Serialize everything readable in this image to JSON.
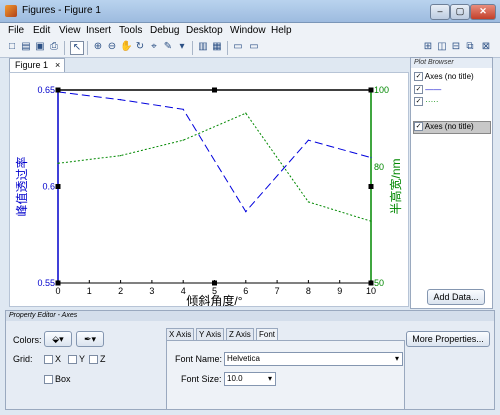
{
  "window": {
    "title": "Figures - Figure 1",
    "min": "–",
    "max": "▢",
    "close": "✕"
  },
  "menu": [
    "File",
    "Edit",
    "View",
    "Insert",
    "Tools",
    "Debug",
    "Desktop",
    "Window",
    "Help"
  ],
  "figure_tab": {
    "label": "Figure 1",
    "close": "×"
  },
  "chart_data": {
    "type": "line",
    "xlabel": "倾斜角度/°",
    "ylabel_left": "峰值透过率",
    "ylabel_right": "半高宽/nm",
    "x": [
      0,
      2,
      4,
      6,
      8,
      10
    ],
    "xticks": [
      "0",
      "1",
      "2",
      "3",
      "4",
      "5",
      "6",
      "7",
      "8",
      "9",
      "10"
    ],
    "xlim": [
      0,
      10
    ],
    "left_axis": {
      "ylim": [
        0.55,
        0.65
      ],
      "ticks": [
        "0.55",
        "0.6",
        "0.65"
      ],
      "color": "#0000cc"
    },
    "right_axis": {
      "ylim": [
        50,
        100
      ],
      "ticks": [
        "50",
        "80",
        "100"
      ],
      "color": "#008800"
    },
    "series": [
      {
        "axis": "left",
        "style": "dashed",
        "color": "#0000dd",
        "values": [
          0.649,
          0.645,
          0.64,
          0.587,
          0.624,
          0.615
        ]
      },
      {
        "axis": "right",
        "style": "dotted",
        "color": "#008800",
        "values": [
          81,
          83,
          87,
          94,
          71,
          66
        ]
      }
    ]
  },
  "plot_browser": {
    "title": "Plot Browser",
    "items": [
      "Axes (no title)",
      "——",
      "·····"
    ],
    "selected_item": "Axes (no title)",
    "add_data": "Add Data..."
  },
  "property_editor": {
    "title": "Property Editor - Axes",
    "colors_label": "Colors:",
    "grid_label": "Grid:",
    "grid_x": "X",
    "grid_y": "Y",
    "grid_z": "Z",
    "box_label": "Box",
    "tabs": [
      "X Axis",
      "Y Axis",
      "Z Axis",
      "Font"
    ],
    "active_tab": "Font",
    "font_name_label": "Font Name:",
    "font_name_value": "Helvetica",
    "font_size_label": "Font Size:",
    "font_size_value": "10.0",
    "more_properties": "More Properties..."
  }
}
